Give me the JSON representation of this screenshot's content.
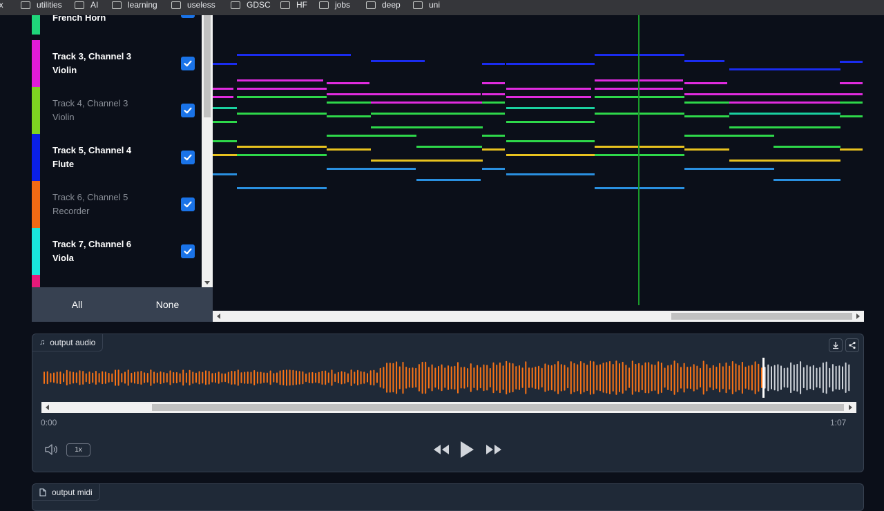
{
  "bookmarks": [
    "ox",
    "utilities",
    "AI",
    "learning",
    "useless",
    "GDSC",
    "HF",
    "jobs",
    "deep",
    "uni"
  ],
  "tracks": [
    {
      "label1": "",
      "label2": "French Horn",
      "color": "#1fd67a",
      "dim": false,
      "checked": true
    },
    {
      "label1": "Track 3, Channel 3",
      "label2": "Violin",
      "color": "#e11bd8",
      "dim": false,
      "checked": true
    },
    {
      "label1": "Track 4, Channel 3",
      "label2": "Violin",
      "color": "#7ed321",
      "dim": true,
      "checked": true
    },
    {
      "label1": "Track 5, Channel 4",
      "label2": "Flute",
      "color": "#0a1fe6",
      "dim": false,
      "checked": true
    },
    {
      "label1": "Track 6, Channel 5",
      "label2": "Recorder",
      "color": "#f06a14",
      "dim": true,
      "checked": true
    },
    {
      "label1": "Track 7, Channel 6",
      "label2": "Viola",
      "color": "#19e6dc",
      "dim": false,
      "checked": true
    },
    {
      "label1": "",
      "label2": "",
      "color": "#e6197a",
      "dim": false,
      "checked": false
    }
  ],
  "selection": {
    "all_label": "All",
    "none_label": "None"
  },
  "audio": {
    "label": "output audio",
    "time_start": "0:00",
    "time_end": "1:07",
    "speed": "1x",
    "played_color": "#f97316",
    "unplayed_color": "#d1d5db"
  },
  "midi": {
    "label": "output midi"
  },
  "colors": {
    "blue": "#1a2cf0",
    "magenta": "#e12be0",
    "green": "#2ed84a",
    "teal": "#1ad0a0",
    "yellow": "#e8c21f",
    "skyblue": "#2a90e0",
    "playhead": "#1a9a2a"
  }
}
